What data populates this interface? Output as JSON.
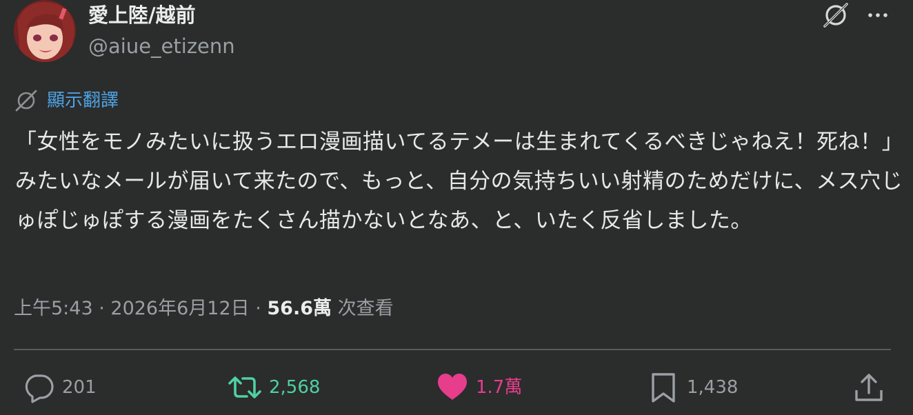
{
  "user": {
    "display_name": "愛上陸/越前",
    "handle": "@aiue_etizenn",
    "avatar_icon": "avatar-image"
  },
  "header": {
    "grok_icon": "grok-icon",
    "more_icon": "more-icon"
  },
  "translate": {
    "label": "顯示翻譯",
    "icon": "translate-icon"
  },
  "tweet": {
    "text": "「女性をモノみたいに扱うエロ漫画描いてるテメーは生まれてくるべきじゃねえ！死ね！」みたいなメールが届いて来たので、もっと、自分の気持ちいい射精のためだけに、メス穴じゅぽじゅぽする漫画をたくさん描かないとなあ、と、いたく反省しました。"
  },
  "meta": {
    "time": "上午5:43",
    "separator": " · ",
    "date": "2026年6月12日",
    "views_count": "56.6萬",
    "views_label": "次查看"
  },
  "actions": {
    "reply": {
      "count": "201",
      "icon": "reply-icon",
      "color": "#9aa0a3"
    },
    "retweet": {
      "count": "2,568",
      "icon": "retweet-icon",
      "color": "#4fd1a2"
    },
    "like": {
      "count": "1.7萬",
      "icon": "heart-icon",
      "color": "#e63d8c"
    },
    "bookmark": {
      "count": "1,438",
      "icon": "bookmark-icon",
      "color": "#9aa0a3"
    },
    "share": {
      "icon": "share-icon",
      "color": "#9aa0a3"
    }
  },
  "colors": {
    "background": "#2b2c2c",
    "link": "#4ea3e4",
    "text": "#e8e8e8",
    "muted": "#9aa0a3"
  }
}
